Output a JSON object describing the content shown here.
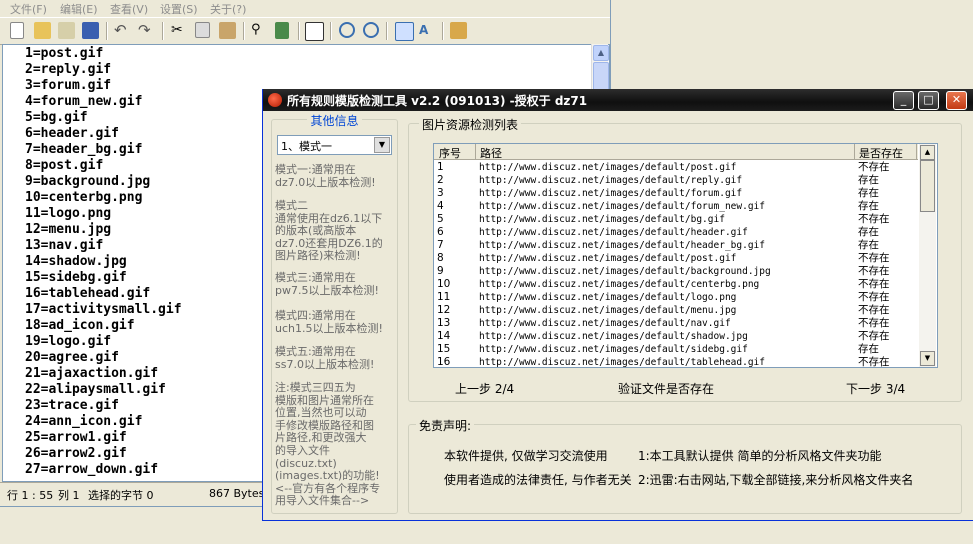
{
  "editor": {
    "menu": [
      "文件(F)",
      "编辑(E)",
      "查看(V)",
      "设置(S)",
      "关于(?)"
    ],
    "lines": [
      "1=post.gif",
      "2=reply.gif",
      "3=forum.gif",
      "4=forum_new.gif",
      "5=bg.gif",
      "6=header.gif",
      "7=header_bg.gif",
      "8=post.gif",
      "9=background.jpg",
      "10=centerbg.png",
      "11=logo.png",
      "12=menu.jpg",
      "13=nav.gif",
      "14=shadow.jpg",
      "15=sidebg.gif",
      "16=tablehead.gif",
      "17=activitysmall.gif",
      "18=ad_icon.gif",
      "19=logo.gif",
      "20=agree.gif",
      "21=ajaxaction.gif",
      "22=alipaysmall.gif",
      "23=trace.gif",
      "24=ann_icon.gif",
      "25=arrow1.gif",
      "26=arrow2.gif",
      "27=arrow_down.gif"
    ],
    "status": {
      "position": "行 1 : 55",
      "column": "列 1",
      "selection": "选择的字节 0",
      "size": "867 Bytes"
    }
  },
  "dialog": {
    "title": "所有规则模版检测工具 v2.2 (091013) -授权于 dz71",
    "info_title": "其他信息",
    "mode_selected": "1、模式一",
    "info_blocks": [
      [
        "模式一:通常用在",
        "dz7.0以上版本检测!"
      ],
      [
        "模式二",
        "通常使用在dz6.1以下",
        "的版本(或高版本",
        "dz7.0还套用DZ6.1的",
        "图片路径)来检测!"
      ],
      [
        "模式三:通常用在",
        "pw7.5以上版本检测!"
      ],
      [
        "模式四:通常用在",
        "uch1.5以上版本检测!"
      ],
      [
        "模式五:通常用在",
        "ss7.0以上版本检测!"
      ],
      [
        "注:模式三四五为",
        "模版和图片通常所在",
        "位置,当然也可以动",
        "手修改模版路径和图",
        "片路径,和更改强大",
        "的导入文件",
        "(discuz.txt)",
        "(images.txt)的功能!",
        "<--官方有各个程序专",
        "用导入文件集合-->"
      ]
    ],
    "list_title": "图片资源检测列表",
    "columns": [
      "序号",
      "路径",
      "是否存在"
    ],
    "rows": [
      [
        "1",
        "http://www.discuz.net/images/default/post.gif",
        "不存在"
      ],
      [
        "2",
        "http://www.discuz.net/images/default/reply.gif",
        "存在"
      ],
      [
        "3",
        "http://www.discuz.net/images/default/forum.gif",
        "存在"
      ],
      [
        "4",
        "http://www.discuz.net/images/default/forum_new.gif",
        "存在"
      ],
      [
        "5",
        "http://www.discuz.net/images/default/bg.gif",
        "不存在"
      ],
      [
        "6",
        "http://www.discuz.net/images/default/header.gif",
        "存在"
      ],
      [
        "7",
        "http://www.discuz.net/images/default/header_bg.gif",
        "存在"
      ],
      [
        "8",
        "http://www.discuz.net/images/default/post.gif",
        "不存在"
      ],
      [
        "9",
        "http://www.discuz.net/images/default/background.jpg",
        "不存在"
      ],
      [
        "10",
        "http://www.discuz.net/images/default/centerbg.png",
        "不存在"
      ],
      [
        "11",
        "http://www.discuz.net/images/default/logo.png",
        "不存在"
      ],
      [
        "12",
        "http://www.discuz.net/images/default/menu.jpg",
        "不存在"
      ],
      [
        "13",
        "http://www.discuz.net/images/default/nav.gif",
        "不存在"
      ],
      [
        "14",
        "http://www.discuz.net/images/default/shadow.jpg",
        "不存在"
      ],
      [
        "15",
        "http://www.discuz.net/images/default/sidebg.gif",
        "存在"
      ],
      [
        "16",
        "http://www.discuz.net/images/default/tablehead.gif",
        "不存在"
      ]
    ],
    "prev_label": "上一步 2/4",
    "verify_label": "验证文件是否存在",
    "next_label": "下一步 3/4",
    "disclaimer_title": "免责声明:",
    "disclaimer": [
      "本软件提供, 仅做学习交流使用",
      "使用者造成的法律责任, 与作者无关",
      "1:本工具默认提供 简单的分析风格文件夹功能",
      "2:迅雷:右击网站,下载全部链接,来分析风格文件夹名"
    ]
  }
}
